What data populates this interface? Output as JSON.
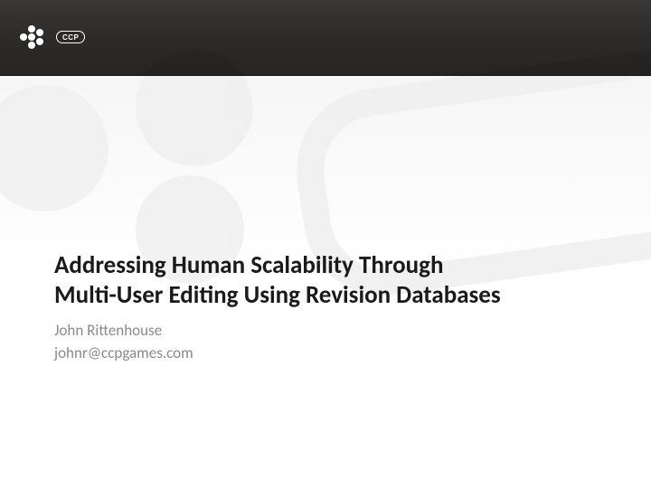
{
  "logo": {
    "text": "CCP"
  },
  "title": {
    "line1": "Addressing Human Scalability Through",
    "line2": "Multi-User Editing Using Revision Databases"
  },
  "author": "John Rittenhouse",
  "email": "johnr@ccpgames.com"
}
